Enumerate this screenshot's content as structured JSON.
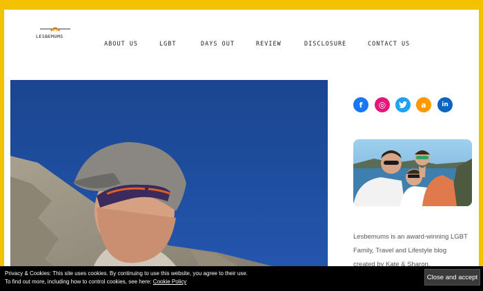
{
  "site": {
    "logo_text": "LESBEMUMS"
  },
  "nav": {
    "items": [
      {
        "label": "ABOUT US"
      },
      {
        "label": "LGBT"
      },
      {
        "label": "DAYS OUT"
      },
      {
        "label": "REVIEW"
      },
      {
        "label": "DISCLOSURE"
      },
      {
        "label": "CONTACT US"
      }
    ]
  },
  "social": {
    "items": [
      {
        "icon": "facebook-icon",
        "glyph": "f",
        "color": "#1877f2"
      },
      {
        "icon": "instagram-icon",
        "glyph": "◎",
        "color": "#e4167c"
      },
      {
        "icon": "twitter-icon",
        "glyph": "🐦",
        "color": "#1da1f2"
      },
      {
        "icon": "amazon-icon",
        "glyph": "a",
        "color": "#ff9900"
      },
      {
        "icon": "linkedin-icon",
        "glyph": "in",
        "color": "#0a66c2"
      }
    ]
  },
  "sidebar": {
    "bio_lines": [
      "Lesbemums is an award-winning LGBT",
      "Family, Travel and Lifestyle blog",
      "created by Kate & Sharon."
    ]
  },
  "cookie": {
    "line1": "Privacy & Cookies: This site uses cookies. By continuing to use this website, you agree to their use.",
    "line2_prefix": "To find out more, including how to control cookies, see here:",
    "policy_link": "Cookie Policy",
    "accept_label": "Close and accept"
  },
  "colors": {
    "border": "#f2c200",
    "sky": "#143f8b"
  }
}
